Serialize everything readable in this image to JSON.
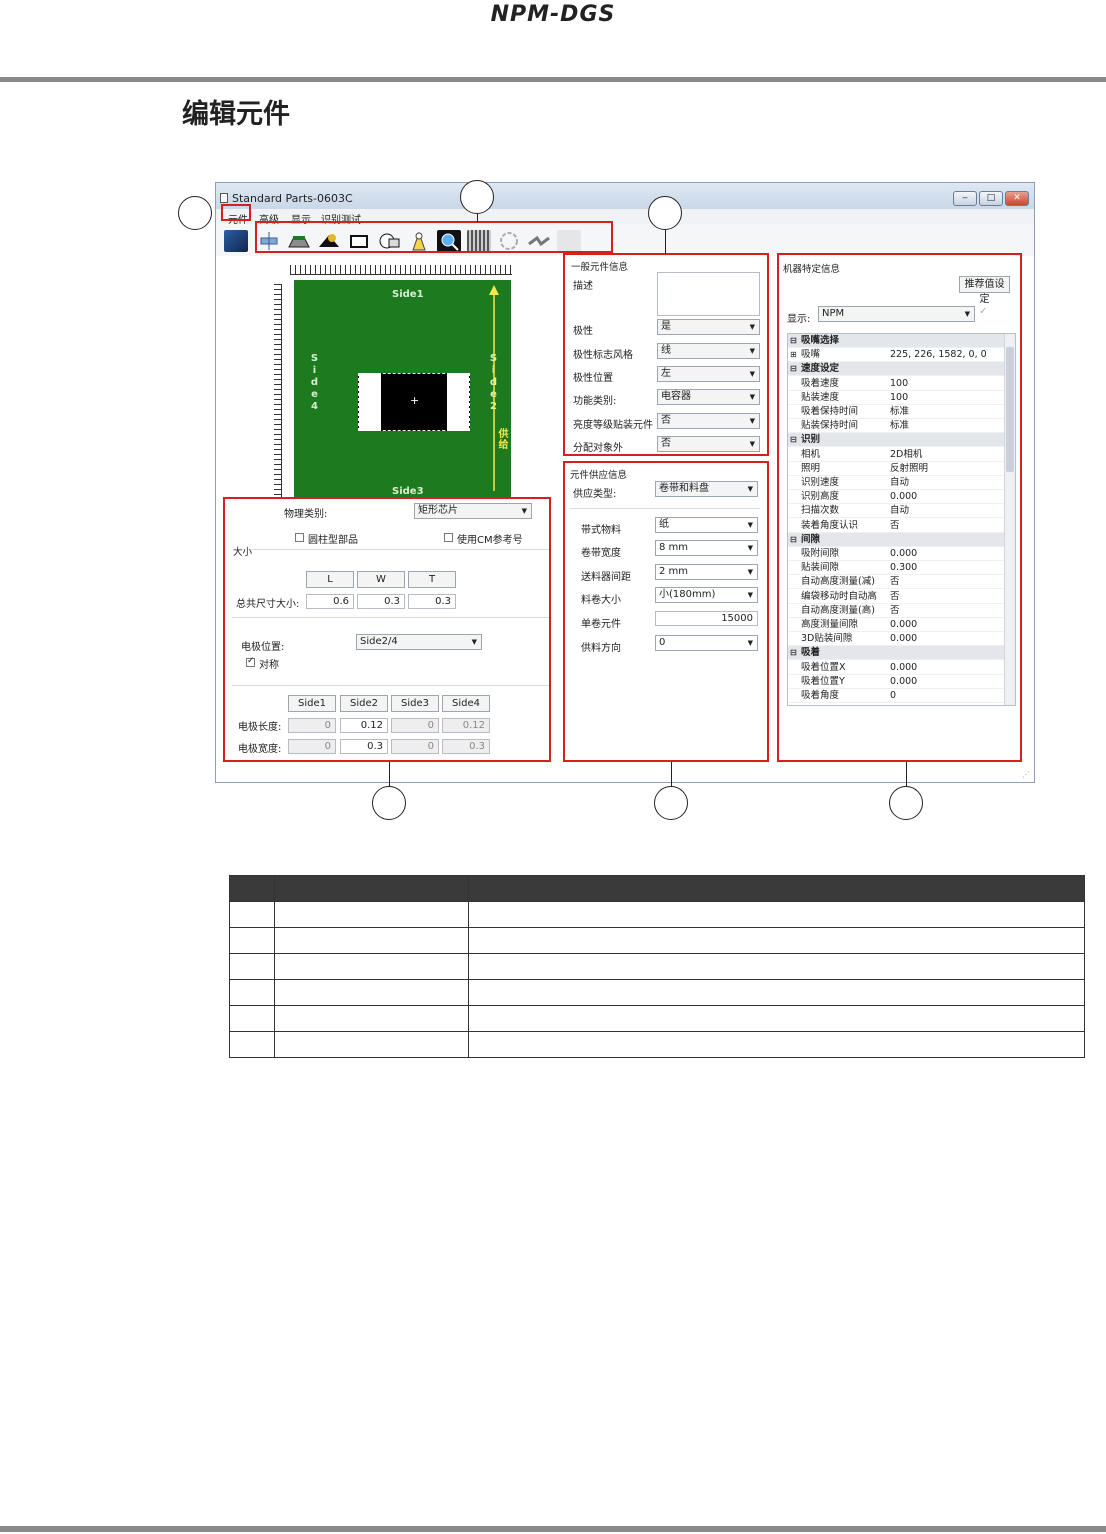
{
  "doc": {
    "header_title": "NPM-DGS",
    "section_title": "编辑元件"
  },
  "window": {
    "title": "Standard Parts-0603C",
    "controls": {
      "minimize": "‒",
      "maximize": "□",
      "close": "✕"
    },
    "menu": [
      "元件",
      "高级",
      "显示",
      "识别测试"
    ],
    "toolbar_icons": [
      "save-icon",
      "nozzle-icon",
      "component-shape-icon",
      "lead-icon",
      "outline-icon",
      "view-icon",
      "scan-icon",
      "magnifier-icon",
      "grid-icon",
      "rotate-icon",
      "transfer-icon",
      "disabled-tool-icon"
    ]
  },
  "canvas": {
    "side1": "Side1",
    "side3": "Side3",
    "side4": "Side4",
    "side2": "Side2",
    "feed": "供给"
  },
  "physical": {
    "type_label": "物理类别:",
    "type_value": "矩形芯片",
    "cylinder_label": "圆柱型部品",
    "cm_ref_label": "使用CM参考号",
    "size_group": "大小",
    "col_L": "L",
    "col_W": "W",
    "col_T": "T",
    "total_label": "总共尺寸大小:",
    "L": "0.6",
    "W": "0.3",
    "T": "0.3",
    "electrode_pos_label": "电极位置:",
    "electrode_pos_value": "Side2/4",
    "symmetric_label": "对称",
    "sides": [
      "Side1",
      "Side2",
      "Side3",
      "Side4"
    ],
    "length_label": "电极长度:",
    "width_label": "电极宽度:",
    "lengths": [
      "0",
      "0.12",
      "0",
      "0.12"
    ],
    "widths": [
      "0",
      "0.3",
      "0",
      "0.3"
    ]
  },
  "general": {
    "group": "一般元件信息",
    "desc_label": "描述",
    "rows": [
      {
        "label": "极性",
        "value": "是"
      },
      {
        "label": "极性标志风格",
        "value": "线"
      },
      {
        "label": "极性位置",
        "value": "左"
      },
      {
        "label": "功能类别:",
        "value": "电容器"
      },
      {
        "label": "亮度等级贴装元件",
        "value": "否"
      },
      {
        "label": "分配对象外",
        "value": "否"
      }
    ]
  },
  "supply": {
    "group": "元件供应信息",
    "type_label": "供应类型:",
    "type_value": "卷带和料盘",
    "rows": [
      {
        "label": "带式物料",
        "value": "纸"
      },
      {
        "label": "卷带宽度",
        "value": "8 mm"
      },
      {
        "label": "送料器间距",
        "value": "2 mm"
      },
      {
        "label": "料卷大小",
        "value": "小(180mm)"
      }
    ],
    "qty_label": "单卷元件",
    "qty_value": "15000",
    "dir_label": "供料方向",
    "dir_value": "0"
  },
  "machine": {
    "group": "机器特定信息",
    "recommend_button": "推荐值设定",
    "display_label": "显示:",
    "display_value": "NPM",
    "rows": [
      {
        "cat": true,
        "m": "⊟",
        "k": "吸嘴选择",
        "v": ""
      },
      {
        "cat": false,
        "m": "⊞",
        "k": "吸嘴",
        "v": "225, 226, 1582, 0, 0"
      },
      {
        "cat": true,
        "m": "⊟",
        "k": "速度设定",
        "v": ""
      },
      {
        "cat": false,
        "m": "",
        "k": "吸着速度",
        "v": "100"
      },
      {
        "cat": false,
        "m": "",
        "k": "贴装速度",
        "v": "100"
      },
      {
        "cat": false,
        "m": "",
        "k": "吸着保持时间",
        "v": "标准"
      },
      {
        "cat": false,
        "m": "",
        "k": "贴装保持时间",
        "v": "标准"
      },
      {
        "cat": true,
        "m": "⊟",
        "k": "识别",
        "v": ""
      },
      {
        "cat": false,
        "m": "",
        "k": "相机",
        "v": "2D相机"
      },
      {
        "cat": false,
        "m": "",
        "k": "照明",
        "v": "反射照明"
      },
      {
        "cat": false,
        "m": "",
        "k": "识别速度",
        "v": "自动"
      },
      {
        "cat": false,
        "m": "",
        "k": "识别高度",
        "v": "0.000"
      },
      {
        "cat": false,
        "m": "",
        "k": "扫描次数",
        "v": "自动"
      },
      {
        "cat": false,
        "m": "",
        "k": "装着角度认识",
        "v": "否"
      },
      {
        "cat": true,
        "m": "⊟",
        "k": "间隙",
        "v": ""
      },
      {
        "cat": false,
        "m": "",
        "k": "吸附间隙",
        "v": "0.000"
      },
      {
        "cat": false,
        "m": "",
        "k": "贴装间隙",
        "v": "0.300"
      },
      {
        "cat": false,
        "m": "",
        "k": "自动高度测量(减)",
        "v": "否"
      },
      {
        "cat": false,
        "m": "",
        "k": "编袋移动时自动高",
        "v": "否"
      },
      {
        "cat": false,
        "m": "",
        "k": "自动高度测量(高)",
        "v": "否"
      },
      {
        "cat": false,
        "m": "",
        "k": "高度测量间隙",
        "v": "0.000"
      },
      {
        "cat": false,
        "m": "",
        "k": "3D贴装间隙",
        "v": "0.000"
      },
      {
        "cat": true,
        "m": "⊟",
        "k": "吸着",
        "v": ""
      },
      {
        "cat": false,
        "m": "",
        "k": "吸着位置X",
        "v": "0.000"
      },
      {
        "cat": false,
        "m": "",
        "k": "吸着位置Y",
        "v": "0.000"
      },
      {
        "cat": false,
        "m": "",
        "k": "吸着角度",
        "v": "0"
      }
    ]
  },
  "colors": {
    "highlight": "#d61f1f",
    "board": "#1e7a1e",
    "header_rule": "#8a8a8a"
  }
}
